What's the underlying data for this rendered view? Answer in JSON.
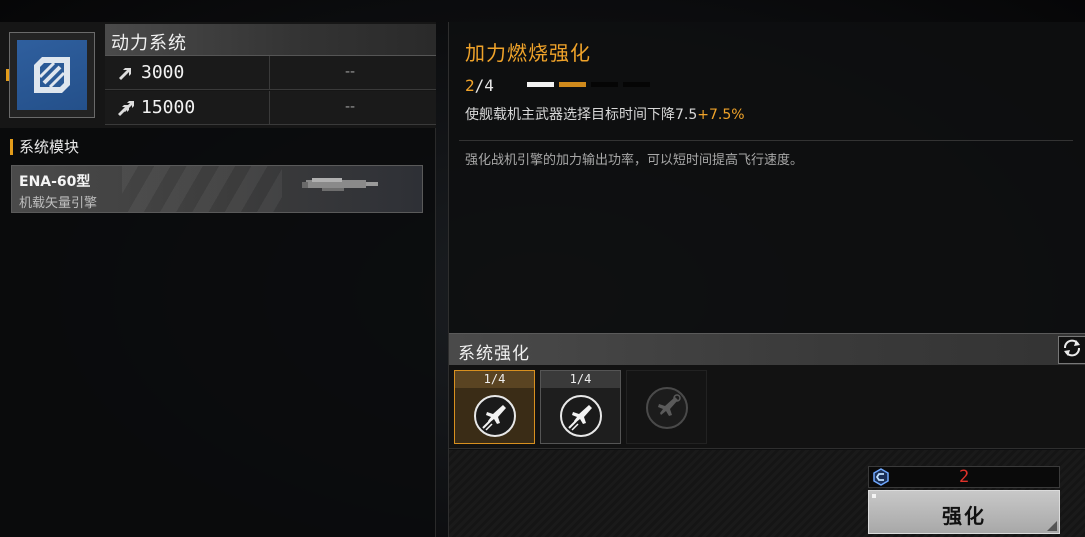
{
  "left_panel": {
    "system_title": "动力系统",
    "icon": "boost-emblem-icon",
    "stats": [
      {
        "icon": "arrow-single-icon",
        "value": "3000",
        "bonus": "--"
      },
      {
        "icon": "arrow-double-icon",
        "value": "15000",
        "bonus": "--"
      }
    ],
    "module_section_label": "系统模块",
    "module": {
      "name": "ENA-60型",
      "subtitle": "机载矢量引擎",
      "image": "engine-module-icon"
    }
  },
  "right_panel": {
    "skill_title": "加力燃烧强化",
    "level_current": "2",
    "level_max": "/4",
    "level_progress": 0.5,
    "pips": [
      "white",
      "orange",
      "dark",
      "dark"
    ],
    "effect_text": "使舰载机主武器选择目标时间下降7.5",
    "effect_bonus": "+7.5%",
    "description": "强化战机引擎的加力输出功率，可以短时间提高飞行速度。",
    "enhancement_section_title": "系统强化",
    "refresh_icon": "refresh-icon",
    "slots": [
      {
        "count": "1/4",
        "icon": "jet-boost-icon",
        "state": "selected"
      },
      {
        "count": "1/4",
        "icon": "jet-boost-icon",
        "state": "normal"
      },
      {
        "count": "",
        "icon": "jet-locked-icon",
        "state": "locked"
      }
    ],
    "cost": {
      "icon": "chip-currency-icon",
      "value": "2"
    },
    "enhance_button_label": "强化"
  },
  "colors": {
    "accent_orange": "#f0a32a",
    "icon_blue": "#2f5f9e",
    "cost_red": "#e0322a"
  }
}
